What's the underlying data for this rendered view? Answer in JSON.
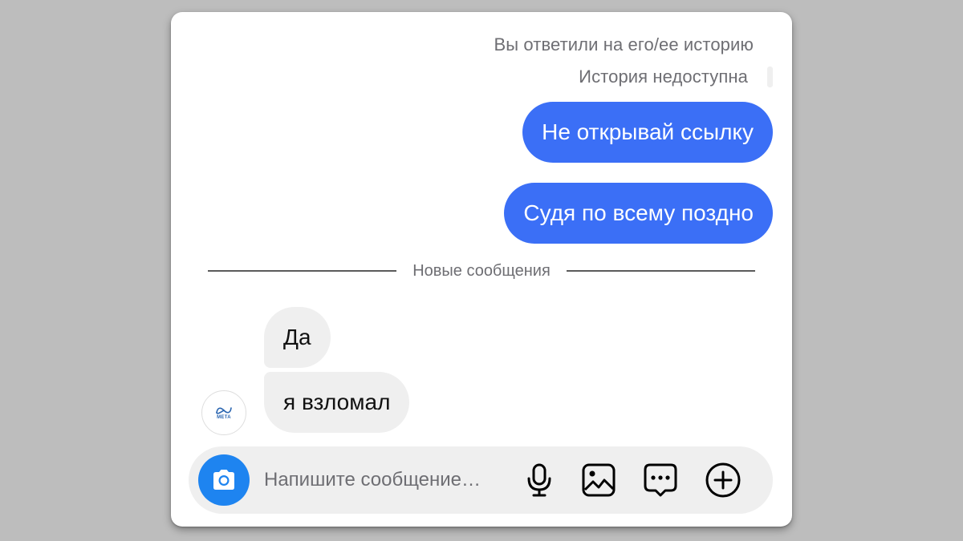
{
  "thread": {
    "replied_note": "Вы ответили на его/ее историю",
    "story_unavailable": "История недоступна",
    "outgoing": [
      {
        "text": "Не открывай ссылку"
      },
      {
        "text": "Судя по всему поздно"
      }
    ],
    "divider_label": "Новые сообщения",
    "incoming": [
      {
        "text": "Да"
      },
      {
        "text": "я взломал"
      }
    ],
    "sender_avatar": {
      "logo_text": "META",
      "icon": "meta-logo-icon"
    }
  },
  "composer": {
    "placeholder": "Напишите сообщение…",
    "icons": [
      "camera-icon",
      "microphone-icon",
      "gallery-icon",
      "sticker-icon",
      "plus-icon"
    ]
  },
  "colors": {
    "outgoing_bubble": "#3b6ff6",
    "incoming_bubble": "#efefef",
    "camera_button": "#1e84f0",
    "background": "#bdbdbd"
  }
}
